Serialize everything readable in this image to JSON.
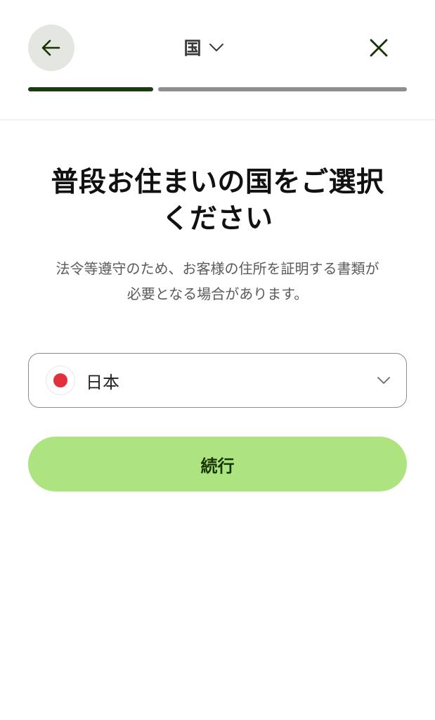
{
  "header": {
    "back_icon": "arrow-left-icon",
    "step_label": "国",
    "step_menu_icon": "chevron-down-icon",
    "close_icon": "close-icon",
    "progress": 0.33
  },
  "main": {
    "title_line1": "普段お住まいの国をご選択",
    "title_line2": "ください",
    "subtitle_line1": "法令等遵守のため、お客様の住所を証明する書類が",
    "subtitle_line2": "必要となる場合があります。",
    "country_select": {
      "value": "日本",
      "flag_icon": "japan-flag-icon",
      "chevron_icon": "chevron-down-icon"
    },
    "continue_label": "続行"
  },
  "colors": {
    "accent": "#ade47f",
    "accent_text": "#163300",
    "progress_done": "#173d0e",
    "progress_todo": "#8e8e8e",
    "back_button_bg": "#e3e6e1",
    "flag_red": "#e2303f"
  }
}
